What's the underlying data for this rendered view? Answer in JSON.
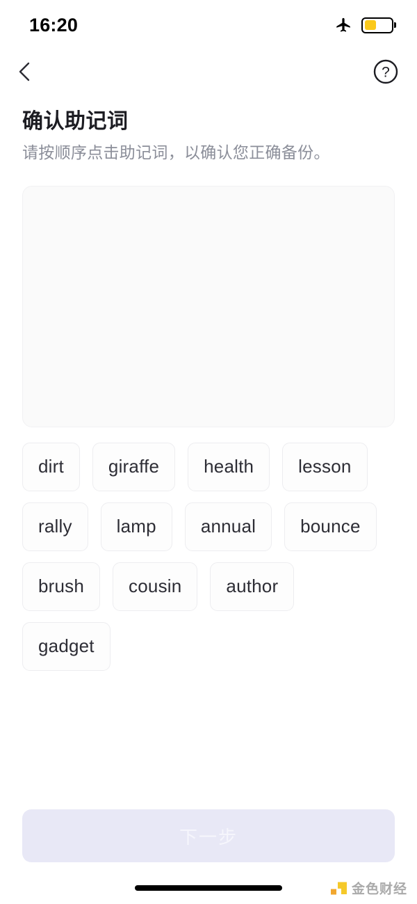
{
  "status_bar": {
    "time": "16:20",
    "airplane_icon": "airplane-icon",
    "battery_icon": "battery-icon",
    "battery_level_percent": 45,
    "battery_fill_color": "#fbc91b",
    "low_power_mode": true
  },
  "nav_bar": {
    "back_icon": "chevron-left-icon",
    "help_icon": "question-mark-circle-icon"
  },
  "header": {
    "title": "确认助记词",
    "subtitle": "请按顺序点击助记词，以确认您正确备份。"
  },
  "answer_panel": {
    "selected_words": [],
    "placeholder": ""
  },
  "word_bank": {
    "words": [
      "dirt",
      "giraffe",
      "health",
      "lesson",
      "rally",
      "lamp",
      "annual",
      "bounce",
      "brush",
      "cousin",
      "author",
      "gadget"
    ]
  },
  "footer": {
    "next_label": "下一步",
    "next_enabled": false,
    "disabled_bg_color": "#e8e8f6",
    "disabled_text_color": "#f6f6fc"
  },
  "bottom_bar": {
    "home_indicator": "home-indicator",
    "watermark_text": "金色财经"
  }
}
